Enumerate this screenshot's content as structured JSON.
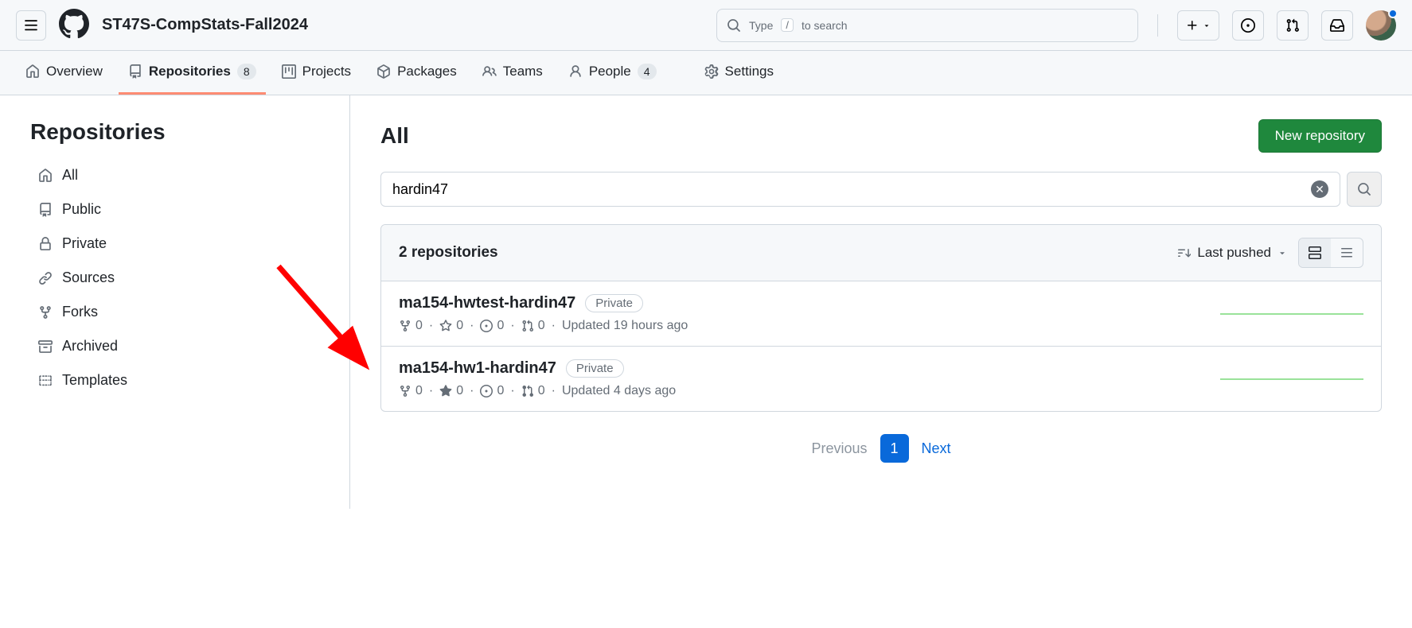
{
  "header": {
    "org_name": "ST47S-CompStats-Fall2024",
    "search_placeholder_left": "Type",
    "search_placeholder_right": "to search",
    "search_kbd": "/"
  },
  "tabs": {
    "overview": "Overview",
    "repositories": "Repositories",
    "repositories_count": "8",
    "projects": "Projects",
    "packages": "Packages",
    "teams": "Teams",
    "people": "People",
    "people_count": "4",
    "settings": "Settings"
  },
  "sidebar": {
    "title": "Repositories",
    "items": {
      "all": "All",
      "public": "Public",
      "private": "Private",
      "sources": "Sources",
      "forks": "Forks",
      "archived": "Archived",
      "templates": "Templates"
    }
  },
  "main": {
    "title": "All",
    "new_repo": "New repository",
    "search_value": "hardin47",
    "results_count": "2 repositories",
    "sort_label": "Last pushed"
  },
  "repos": [
    {
      "name": "ma154-hwtest-hardin47",
      "visibility": "Private",
      "forks": "0",
      "stars": "0",
      "issues": "0",
      "prs": "0",
      "updated": "Updated 19 hours ago"
    },
    {
      "name": "ma154-hw1-hardin47",
      "visibility": "Private",
      "forks": "0",
      "stars": "0",
      "issues": "0",
      "prs": "0",
      "updated": "Updated 4 days ago"
    }
  ],
  "pager": {
    "prev": "Previous",
    "current": "1",
    "next": "Next"
  }
}
